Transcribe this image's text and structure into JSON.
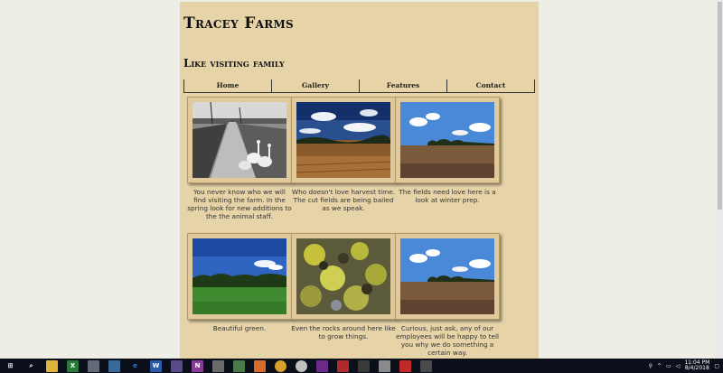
{
  "site": {
    "title": "Tracey Farms",
    "subtitle": "Like visiting family"
  },
  "nav": {
    "items": [
      "Home",
      "Gallery",
      "Features",
      "Contact"
    ]
  },
  "gallery": {
    "captions": [
      "You never know who we will find visiting the farm. In the spring look for new additions to the the animal staff.",
      "Who doesn't love harvest time. The cut fields are being bailed as we speak.",
      "The fields need love here is a look at winter prep.",
      "Beautiful green.",
      "Even the rocks around here like to grow things.",
      "Curious, just ask, any of our employees will be happy to tell you why we do something a certain way."
    ],
    "photos": [
      "geese-on-road",
      "harvest-field",
      "plowed-field",
      "green-meadow",
      "lichen-rocks",
      "plowed-field-2"
    ]
  },
  "taskbar": {
    "time": "11:04 PM",
    "date": "8/4/2018"
  }
}
